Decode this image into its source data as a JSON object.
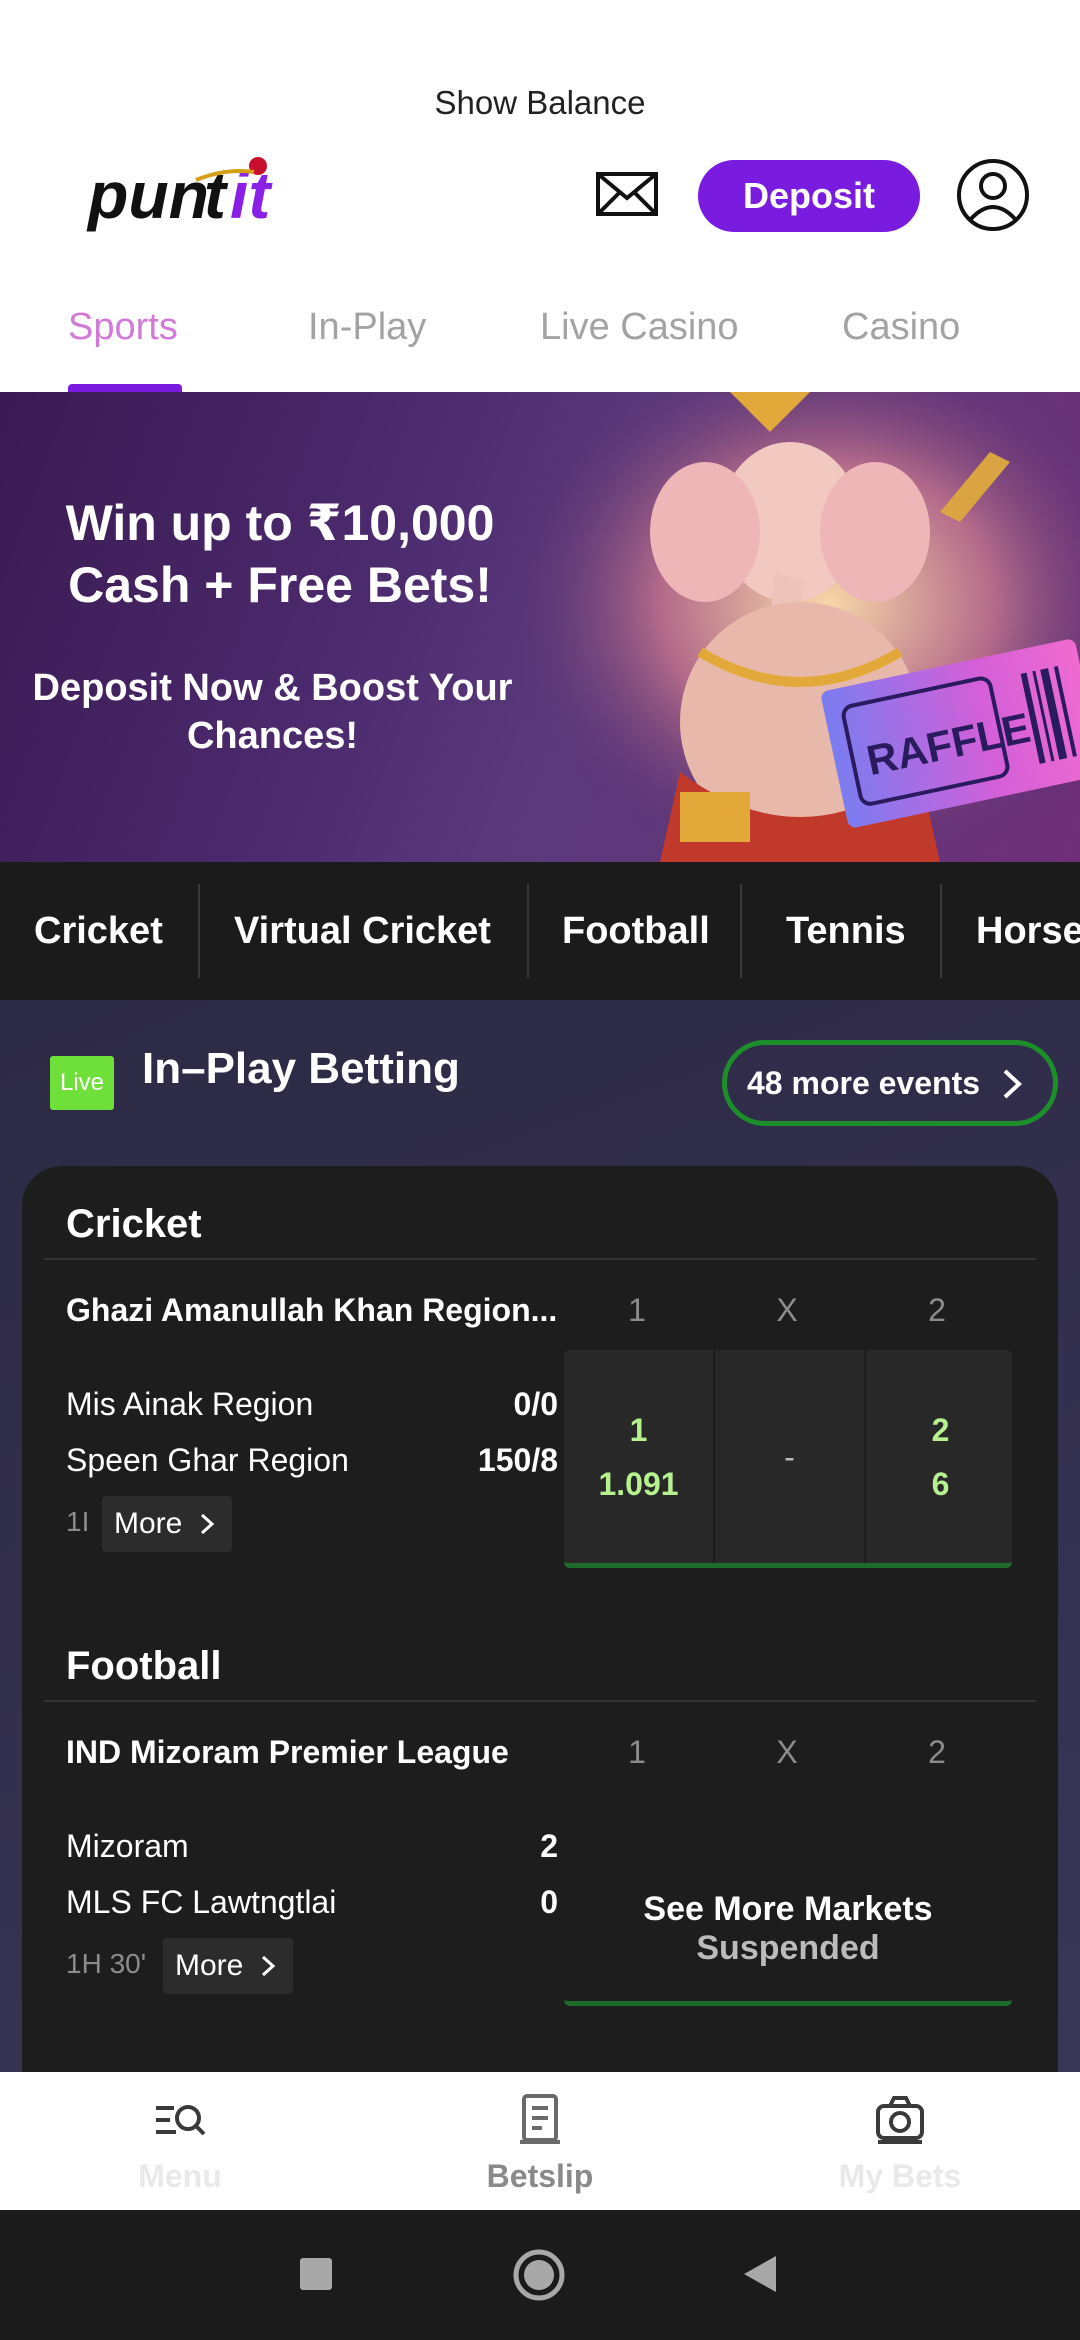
{
  "header": {
    "show_balance": "Show Balance",
    "logo_text": "puntit",
    "deposit_label": "Deposit"
  },
  "tabs": [
    {
      "label": "Sports",
      "active": true
    },
    {
      "label": "In-Play",
      "active": false
    },
    {
      "label": "Live Casino",
      "active": false
    },
    {
      "label": "Casino",
      "active": false
    }
  ],
  "banner": {
    "title_line1": "Win up to ₹10,000",
    "title_line2": "Cash + Free Bets!",
    "sub_line1": "Deposit Now & Boost Your",
    "sub_line2": "Chances!",
    "ticket_text": "RAFFLE"
  },
  "sports": [
    "Cricket",
    "Virtual Cricket",
    "Football",
    "Tennis",
    "Horse"
  ],
  "inplay": {
    "badge": "Live",
    "title": "In–Play Betting",
    "more_events": "48 more events",
    "more_label": "More",
    "col_1": "1",
    "col_x": "X",
    "col_2": "2",
    "sections": [
      {
        "title": "Cricket",
        "league": "Ghazi Amanullah Khan Region...",
        "team1": "Mis Ainak Region",
        "score1": "0/0",
        "team2": "Speen Ghar Region",
        "score2": "150/8",
        "status": "1I",
        "odds": [
          {
            "label": "1",
            "value": "1.091"
          },
          {
            "label": "",
            "value": "-"
          },
          {
            "label": "2",
            "value": "6"
          }
        ]
      },
      {
        "title": "Football",
        "league": "IND Mizoram Premier League",
        "team1": "Mizoram",
        "score1": "2",
        "team2": "MLS FC Lawtngtlai",
        "score2": "0",
        "status": "1H  30'",
        "suspended_line1": "See More Markets",
        "suspended_line2": "Suspended"
      }
    ]
  },
  "bottom_nav": [
    {
      "label": "Menu",
      "icon": "menu-search-icon"
    },
    {
      "label": "Betslip",
      "icon": "betslip-icon"
    },
    {
      "label": "My Bets",
      "icon": "my-bets-icon"
    }
  ],
  "colors": {
    "brand_purple": "#7a1be0",
    "active_tab": "#d27ad8",
    "live_green": "#6fe03a",
    "odds_green": "#b7f08f"
  }
}
